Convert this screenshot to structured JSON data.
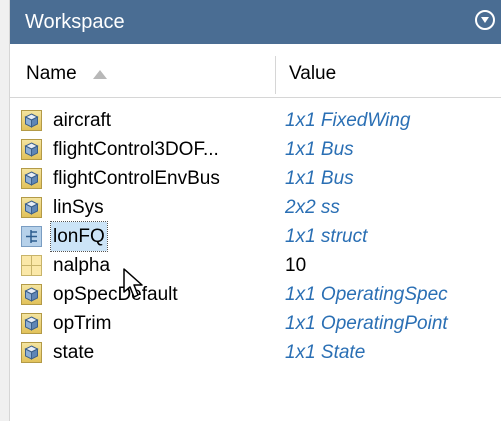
{
  "workspace": {
    "title": "Workspace",
    "header": {
      "name": "Name",
      "value": "Value",
      "sort": "ascending"
    },
    "rows": [
      {
        "name": "aircraft",
        "value": "1x1 FixedWing",
        "icon": "object-icon",
        "value_style": "italic-blue",
        "selected": false
      },
      {
        "name": "flightControl3DOF...",
        "value": "1x1 Bus",
        "icon": "object-icon",
        "value_style": "italic-blue",
        "selected": false
      },
      {
        "name": "flightControlEnvBus",
        "value": "1x1 Bus",
        "icon": "object-icon",
        "value_style": "italic-blue",
        "selected": false
      },
      {
        "name": "linSys",
        "value": "2x2 ss",
        "icon": "object-icon",
        "value_style": "italic-blue",
        "selected": false
      },
      {
        "name": "lonFQ",
        "value": "1x1 struct",
        "icon": "struct-icon",
        "value_style": "italic-blue",
        "selected": true
      },
      {
        "name": "nalpha",
        "value": "10",
        "icon": "numeric-icon",
        "value_style": "plain",
        "selected": false
      },
      {
        "name": "opSpecDefault",
        "value": "1x1 OperatingSpec",
        "icon": "object-icon",
        "value_style": "italic-blue",
        "selected": false
      },
      {
        "name": "opTrim",
        "value": "1x1 OperatingPoint",
        "icon": "object-icon",
        "value_style": "italic-blue",
        "selected": false
      },
      {
        "name": "state",
        "value": "1x1 State",
        "icon": "object-icon",
        "value_style": "italic-blue",
        "selected": false
      }
    ]
  },
  "colors": {
    "titlebar": "#4a6d93",
    "value_text": "#2a6fb4",
    "selection": "#cce4f7"
  }
}
